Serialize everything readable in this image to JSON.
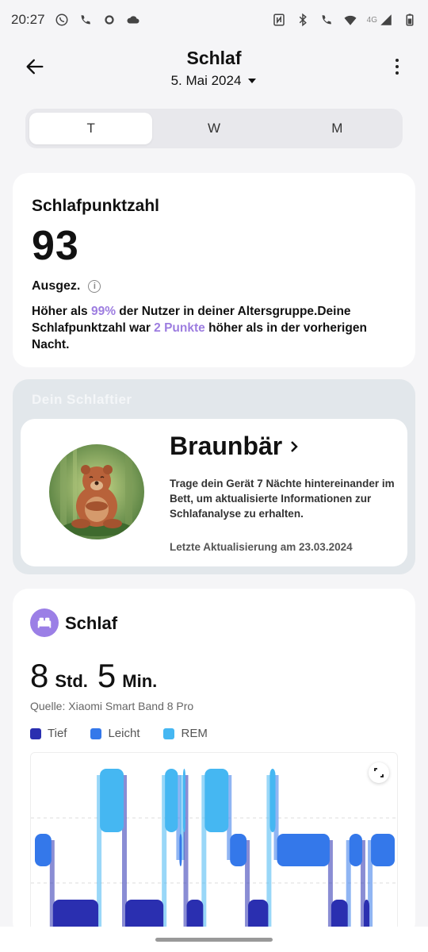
{
  "status_bar": {
    "time": "20:27",
    "network": "4G"
  },
  "header": {
    "title": "Schlaf",
    "date": "5. Mai 2024"
  },
  "tabs": [
    {
      "label": "T",
      "active": true
    },
    {
      "label": "W",
      "active": false
    },
    {
      "label": "M",
      "active": false
    }
  ],
  "score": {
    "title": "Schlafpunktzahl",
    "value": "93",
    "quality": "Ausgez.",
    "desc_part1": "Höher als ",
    "desc_pct": "99%",
    "desc_part2": " der Nutzer in deiner Altersgruppe.Deine Schlafpunktzahl war ",
    "desc_pts": "2 Punkte",
    "desc_part3": " höher als in der vorherigen Nacht."
  },
  "sleep_animal": {
    "label": "Dein Schlaftier",
    "name": "Braunbär",
    "desc": "Trage dein Gerät 7 Nächte hintereinander im Bett, um aktualisierte Informationen zur Schlafanalyse zu erhalten.",
    "updated": "Letzte Aktualisierung am 23.03.2024"
  },
  "sleep": {
    "title": "Schlaf",
    "hours": "8",
    "hours_unit": "Std.",
    "minutes": "5",
    "minutes_unit": "Min.",
    "source": "Quelle: Xiaomi Smart Band 8 Pro",
    "legend": [
      {
        "label": "Tief",
        "color": "#2a2fb0"
      },
      {
        "label": "Leicht",
        "color": "#3478ea"
      },
      {
        "label": "REM",
        "color": "#45b7f2"
      }
    ]
  },
  "colors": {
    "accent": "#9d7de0",
    "deep": "#2a2fb0",
    "light": "#3478ea",
    "rem": "#45b7f2"
  },
  "chart_data": {
    "type": "area",
    "series_order": [
      "REM",
      "Leicht",
      "Tief"
    ],
    "segments": [
      {
        "stage": "Leicht",
        "start": 0.0,
        "end": 0.05
      },
      {
        "stage": "Tief",
        "start": 0.05,
        "end": 0.18
      },
      {
        "stage": "REM",
        "start": 0.18,
        "end": 0.25
      },
      {
        "stage": "Tief",
        "start": 0.25,
        "end": 0.36
      },
      {
        "stage": "REM",
        "start": 0.36,
        "end": 0.4
      },
      {
        "stage": "Leicht",
        "start": 0.4,
        "end": 0.41
      },
      {
        "stage": "REM",
        "start": 0.41,
        "end": 0.42
      },
      {
        "stage": "Tief",
        "start": 0.42,
        "end": 0.47
      },
      {
        "stage": "REM",
        "start": 0.47,
        "end": 0.54
      },
      {
        "stage": "Leicht",
        "start": 0.54,
        "end": 0.59
      },
      {
        "stage": "Tief",
        "start": 0.59,
        "end": 0.65
      },
      {
        "stage": "REM",
        "start": 0.65,
        "end": 0.67
      },
      {
        "stage": "Leicht",
        "start": 0.67,
        "end": 0.82
      },
      {
        "stage": "Tief",
        "start": 0.82,
        "end": 0.87
      },
      {
        "stage": "Leicht",
        "start": 0.87,
        "end": 0.91
      },
      {
        "stage": "Tief",
        "start": 0.91,
        "end": 0.93
      },
      {
        "stage": "Leicht",
        "start": 0.93,
        "end": 1.0
      }
    ]
  }
}
